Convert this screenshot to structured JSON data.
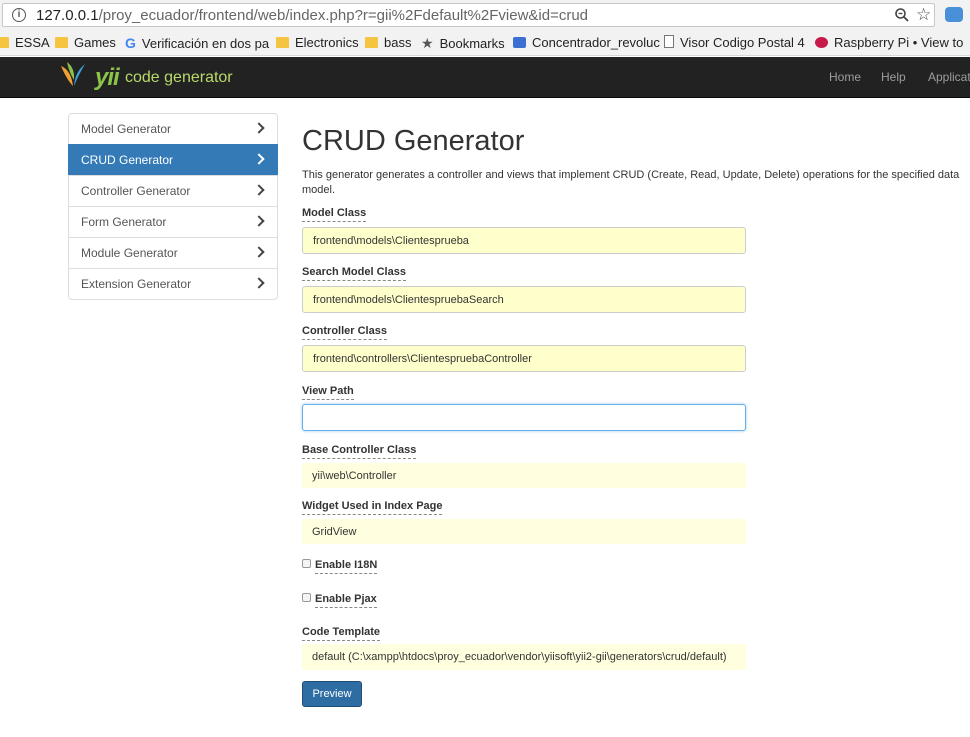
{
  "browser": {
    "url_host": "127.0.0.1",
    "url_rest": "/proy_ecuador/frontend/web/index.php?r=gii%2Fdefault%2Fview&id=crud",
    "bookmarks": [
      "ESSA",
      "Games",
      "Verificación en dos pa",
      "Electronics",
      "bass",
      "Bookmarks",
      "Concentrador_revoluc",
      "Visor Codigo Postal 4",
      "Raspberry Pi • View to"
    ]
  },
  "navbar": {
    "logo_text": "yii",
    "logo_subtitle": "code generator",
    "links": [
      "Home",
      "Help",
      "Applicatio"
    ]
  },
  "sidebar": {
    "items": [
      {
        "label": "Model Generator"
      },
      {
        "label": "CRUD Generator"
      },
      {
        "label": "Controller Generator"
      },
      {
        "label": "Form Generator"
      },
      {
        "label": "Module Generator"
      },
      {
        "label": "Extension Generator"
      }
    ],
    "active": "CRUD Generator"
  },
  "main": {
    "title": "CRUD Generator",
    "description": "This generator generates a controller and views that implement CRUD (Create, Read, Update, Delete) operations for the specified data model.",
    "fields": {
      "model_class": {
        "label": "Model Class",
        "value": "frontend\\models\\Clientesprueba"
      },
      "search_model_class": {
        "label": "Search Model Class",
        "value": "frontend\\models\\ClientespruebaSearch"
      },
      "controller_class": {
        "label": "Controller Class",
        "value": "frontend\\controllers\\ClientespruebaController"
      },
      "view_path": {
        "label": "View Path",
        "value": ""
      },
      "base_controller_class": {
        "label": "Base Controller Class",
        "value": "yii\\web\\Controller"
      },
      "widget_index": {
        "label": "Widget Used in Index Page",
        "value": "GridView"
      },
      "enable_i18n": {
        "label": "Enable I18N"
      },
      "enable_pjax": {
        "label": "Enable Pjax"
      },
      "code_template": {
        "label": "Code Template",
        "value": "default (C:\\xampp\\htdocs\\proy_ecuador\\vendor\\yiisoft\\yii2-gii\\generators\\crud/default)"
      }
    },
    "preview_label": "Preview"
  },
  "colors": {
    "navbar_bg": "#222222",
    "active_item": "#337ab7",
    "sticky_bg": "#ffffcc",
    "button": "#2e6da4"
  }
}
